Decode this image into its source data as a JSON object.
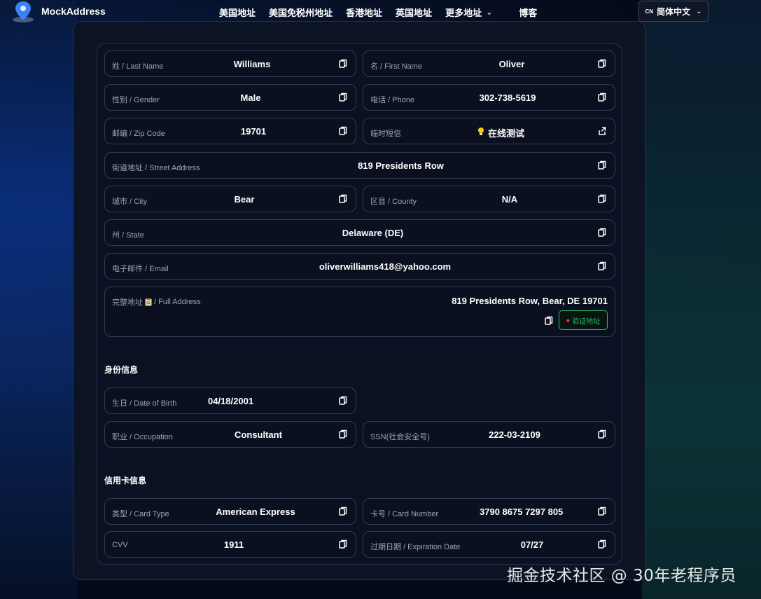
{
  "brand": {
    "name": "MockAddress"
  },
  "nav": {
    "links": [
      "美国地址",
      "美国免税州地址",
      "香港地址",
      "英国地址",
      "更多地址",
      "博客"
    ],
    "lang_code": "CN",
    "lang_label": "简体中文"
  },
  "address": {
    "last_name": {
      "label": "姓 / Last Name",
      "value": "Williams"
    },
    "first_name": {
      "label": "名 / First Name",
      "value": "Oliver"
    },
    "gender": {
      "label": "性别 / Gender",
      "value": "Male"
    },
    "phone": {
      "label": "电话 / Phone",
      "value": "302-738-5619"
    },
    "zip": {
      "label": "邮编 / Zip Code",
      "value": "19701"
    },
    "sms": {
      "label": "临时短信",
      "value": "在线测试"
    },
    "street": {
      "label": "街道地址 / Street Address",
      "value": "819 Presidents Row"
    },
    "city": {
      "label": "城市 / City",
      "value": "Bear"
    },
    "county": {
      "label": "区县 / County",
      "value": "N/A"
    },
    "state": {
      "label": "州 / State",
      "value": "Delaware (DE)"
    },
    "email": {
      "label": "电子邮件 / Email",
      "value": "oliverwilliams418@yahoo.com"
    },
    "full_address": {
      "label_pre": "完整地址",
      "label_post": "/ Full Address",
      "value": "819 Presidents Row, Bear, DE 19701",
      "verify_label": "验证地址"
    }
  },
  "identity": {
    "title": "身份信息",
    "dob": {
      "label": "生日 / Date of Birth",
      "value": "04/18/2001"
    },
    "occupation": {
      "label": "职业 / Occupation",
      "value": "Consultant"
    },
    "ssn": {
      "label": "SSN(社会安全号)",
      "value": "222-03-2109"
    }
  },
  "credit_card": {
    "title": "信用卡信息",
    "type": {
      "label": "类型 / Card Type",
      "value": "American Express"
    },
    "number": {
      "label": "卡号 / Card Number",
      "value": "3790 8675 7297 805"
    },
    "cvv": {
      "label": "CVV",
      "value": "1911"
    },
    "expiry": {
      "label": "过期日期 / Expiration Date",
      "value": "07/27"
    }
  },
  "watermark": "掘金技术社区 @ 30年老程序员",
  "colors": {
    "accent_green": "#22c55e",
    "panel_bg": "#0a1122",
    "border": "#333d52"
  }
}
